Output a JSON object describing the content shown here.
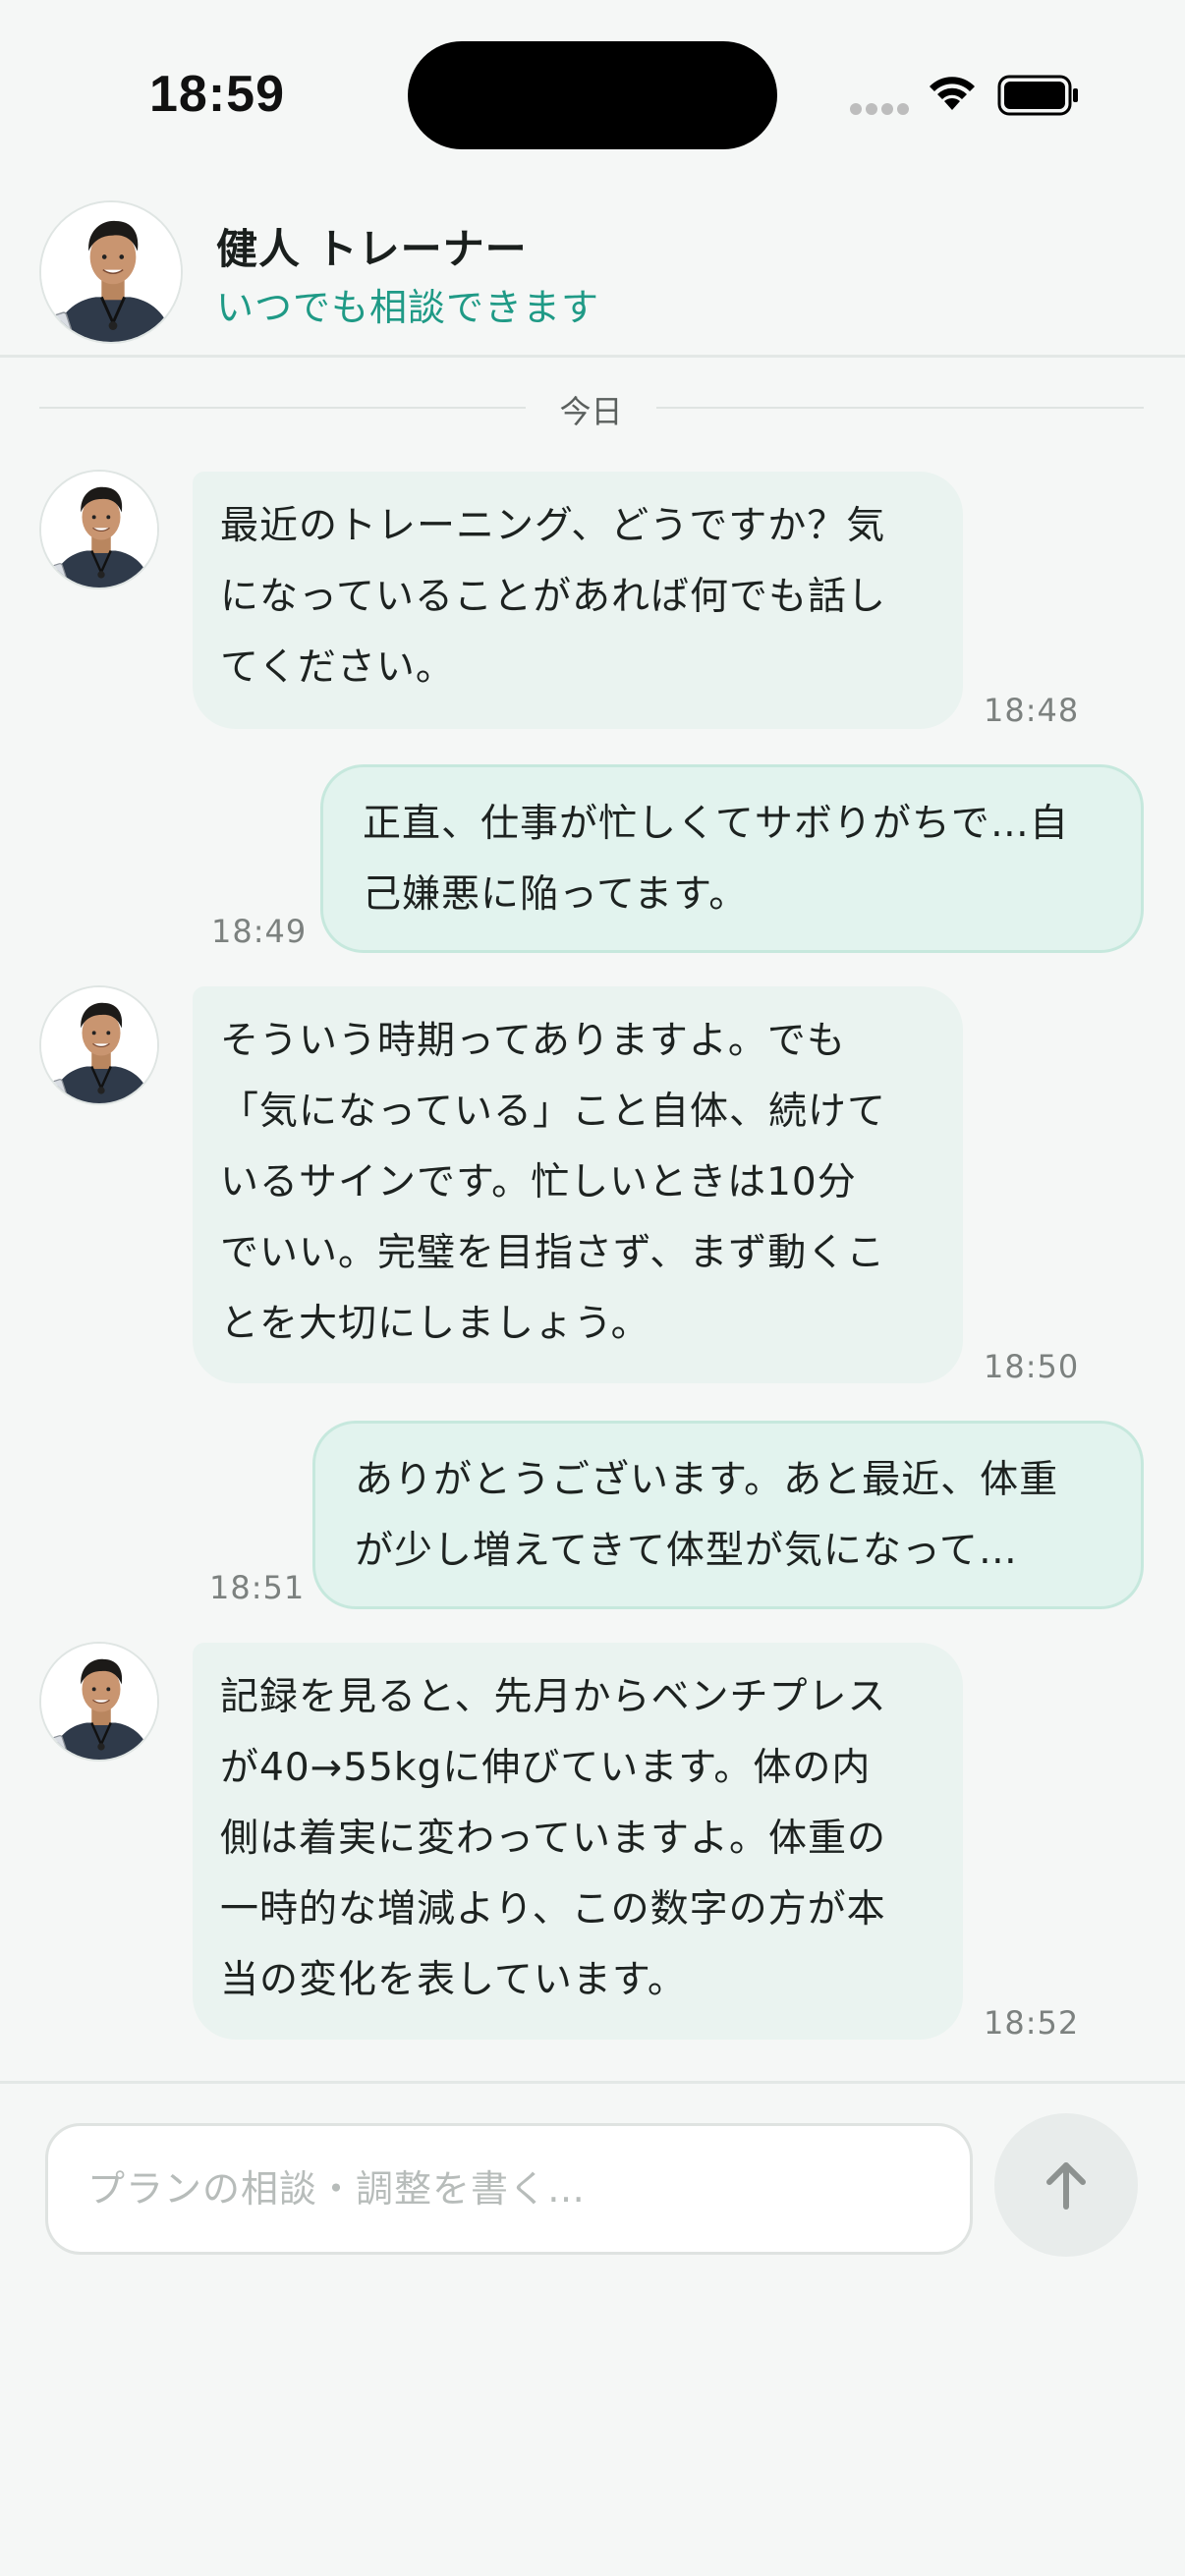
{
  "status_bar": {
    "time": "18:59",
    "icons": [
      "cellular-signal-icon",
      "wifi-icon",
      "battery-icon"
    ]
  },
  "header": {
    "trainer_name": "健人 トレーナー",
    "trainer_status": "いつでも相談できます",
    "avatar_icon": "trainer-avatar"
  },
  "date_divider": {
    "label": "今日"
  },
  "messages": [
    {
      "sender": "trainer",
      "text": "最近のトレーニング、どうですか？気\nになっていることがあれば何でも話し\nてください。",
      "time": "18:48"
    },
    {
      "sender": "user",
      "text": "正直、仕事が忙しくてサボりがちで…自\n己嫌悪に陥ってます。",
      "time": "18:49"
    },
    {
      "sender": "trainer",
      "text": "そういう時期ってありますよ。でも\n「気になっている」こと自体、続けて\nいるサインです。忙しいときは10分\nでいい。完璧を目指さず、まず動くこ\nとを大切にしましょう。",
      "time": "18:50"
    },
    {
      "sender": "user",
      "text": "ありがとうございます。あと最近、体重\nが少し増えてきて体型が気になって…",
      "time": "18:51"
    },
    {
      "sender": "trainer",
      "text": "記録を見ると、先月からベンチプレス\nが40→55kgに伸びています。体の内\n側は着実に変わっていますよ。体重の\n一時的な増減より、この数字の方が本\n当の変化を表しています。",
      "time": "18:52"
    }
  ],
  "composer": {
    "placeholder": "プランの相談・調整を書く…",
    "value": "",
    "send_icon": "arrow-up-icon"
  },
  "colors": {
    "accent": "#1f9a86",
    "background": "#f5f7f6",
    "trainer_bubble": "#eaf3f0",
    "user_bubble": "#e2f3ee",
    "user_bubble_border": "#c6e8dd"
  }
}
